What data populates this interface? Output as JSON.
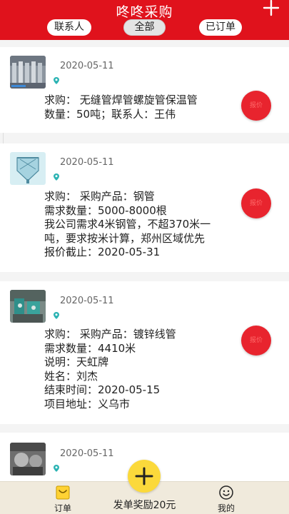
{
  "header": {
    "title": "咚咚采购",
    "tabs": [
      {
        "label": "联系人"
      },
      {
        "label": "全部"
      },
      {
        "label": "已订单"
      }
    ]
  },
  "cards": [
    {
      "date": "2020-05-11",
      "lines": [
        "求购： 无缝管焊管螺旋管保温管",
        "数量：50吨；联系人：王伟"
      ],
      "action": "报价"
    },
    {
      "date": "2020-05-11",
      "lines": [
        "求购： 采购产品：钢管",
        "需求数量：5000-8000根",
        "我公司需求4米钢管，不超370米一",
        "吨，要求按米计算，郑州区域优先",
        "报价截止：2020-05-31"
      ],
      "action": "报价"
    },
    {
      "date": "2020-05-11",
      "lines": [
        "求购： 采购产品：镀锌线管",
        "需求数量：4410米",
        "说明：天虹牌",
        "姓名：刘杰",
        "结束时间：2020-05-15",
        "项目地址：义乌市"
      ],
      "action": "报价"
    },
    {
      "date": "2020-05-11",
      "lines": [],
      "action": ""
    }
  ],
  "bottom_nav": {
    "orders_label": "订单",
    "reward_label": "发单奖励20元",
    "mine_label": "我的"
  },
  "colors": {
    "header": "#e0121c",
    "accent_button": "#e8242e",
    "fab": "#fbd93b",
    "nav_bg": "#f0eadc"
  }
}
